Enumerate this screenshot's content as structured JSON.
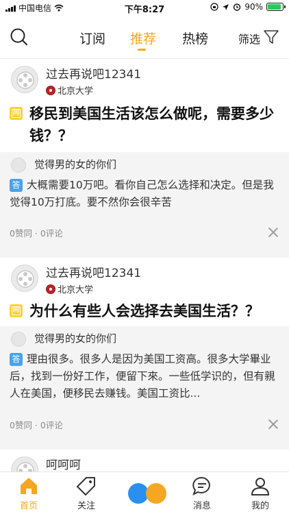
{
  "status_bar": {
    "carrier": "中国电信",
    "time": "下午8:27",
    "battery_percent": "90%",
    "battery_level": 0.9
  },
  "nav": {
    "tabs": [
      {
        "label": "订阅"
      },
      {
        "label": "推荐"
      },
      {
        "label": "热榜"
      }
    ],
    "active_tab": "推荐",
    "filter_label": "筛选"
  },
  "feed": [
    {
      "author": "过去再说吧12341",
      "school": "北京大学",
      "question": "移民到美国生活该怎么做呢，需要多少钱？？",
      "answer_author": "觉得男的女的你们",
      "answer_badge": "答",
      "answer": "大概需要10万吧。看你自己怎么选择和决定。但是我觉得10万打底。要不然你会很辛苦",
      "meta": "0赞同 · 0评论"
    },
    {
      "author": "过去再说吧12341",
      "school": "北京大学",
      "question": "为什么有些人会选择去美国生活？？",
      "answer_author": "觉得男的女的你们",
      "answer_badge": "答",
      "answer": "理由很多。很多人是因为美国工资高。很多大学畢业后，找到一份好工作，便留下來。一些低学识的，但有親人在美国，便移民去赚钱。美国工资比...",
      "meta": "0赞同 · 0评论"
    },
    {
      "author": "呵呵呵"
    }
  ],
  "question_badge": "问",
  "bottom_bar": {
    "items": [
      {
        "label": "首页"
      },
      {
        "label": "关注"
      },
      {
        "label": "消息"
      },
      {
        "label": "我的"
      }
    ]
  },
  "colors": {
    "accent": "#f5a623",
    "answer_badge": "#4aa3e8",
    "question_badge": "#ffd230",
    "dot_blue": "#2b8ff0",
    "dot_orange": "#f5a623"
  },
  "icons": {
    "search": "search-icon",
    "filter": "filter-icon",
    "close": "close-icon",
    "home": "home-icon",
    "follow": "tag-icon",
    "messages": "chat-bubble-icon",
    "me": "user-icon"
  }
}
